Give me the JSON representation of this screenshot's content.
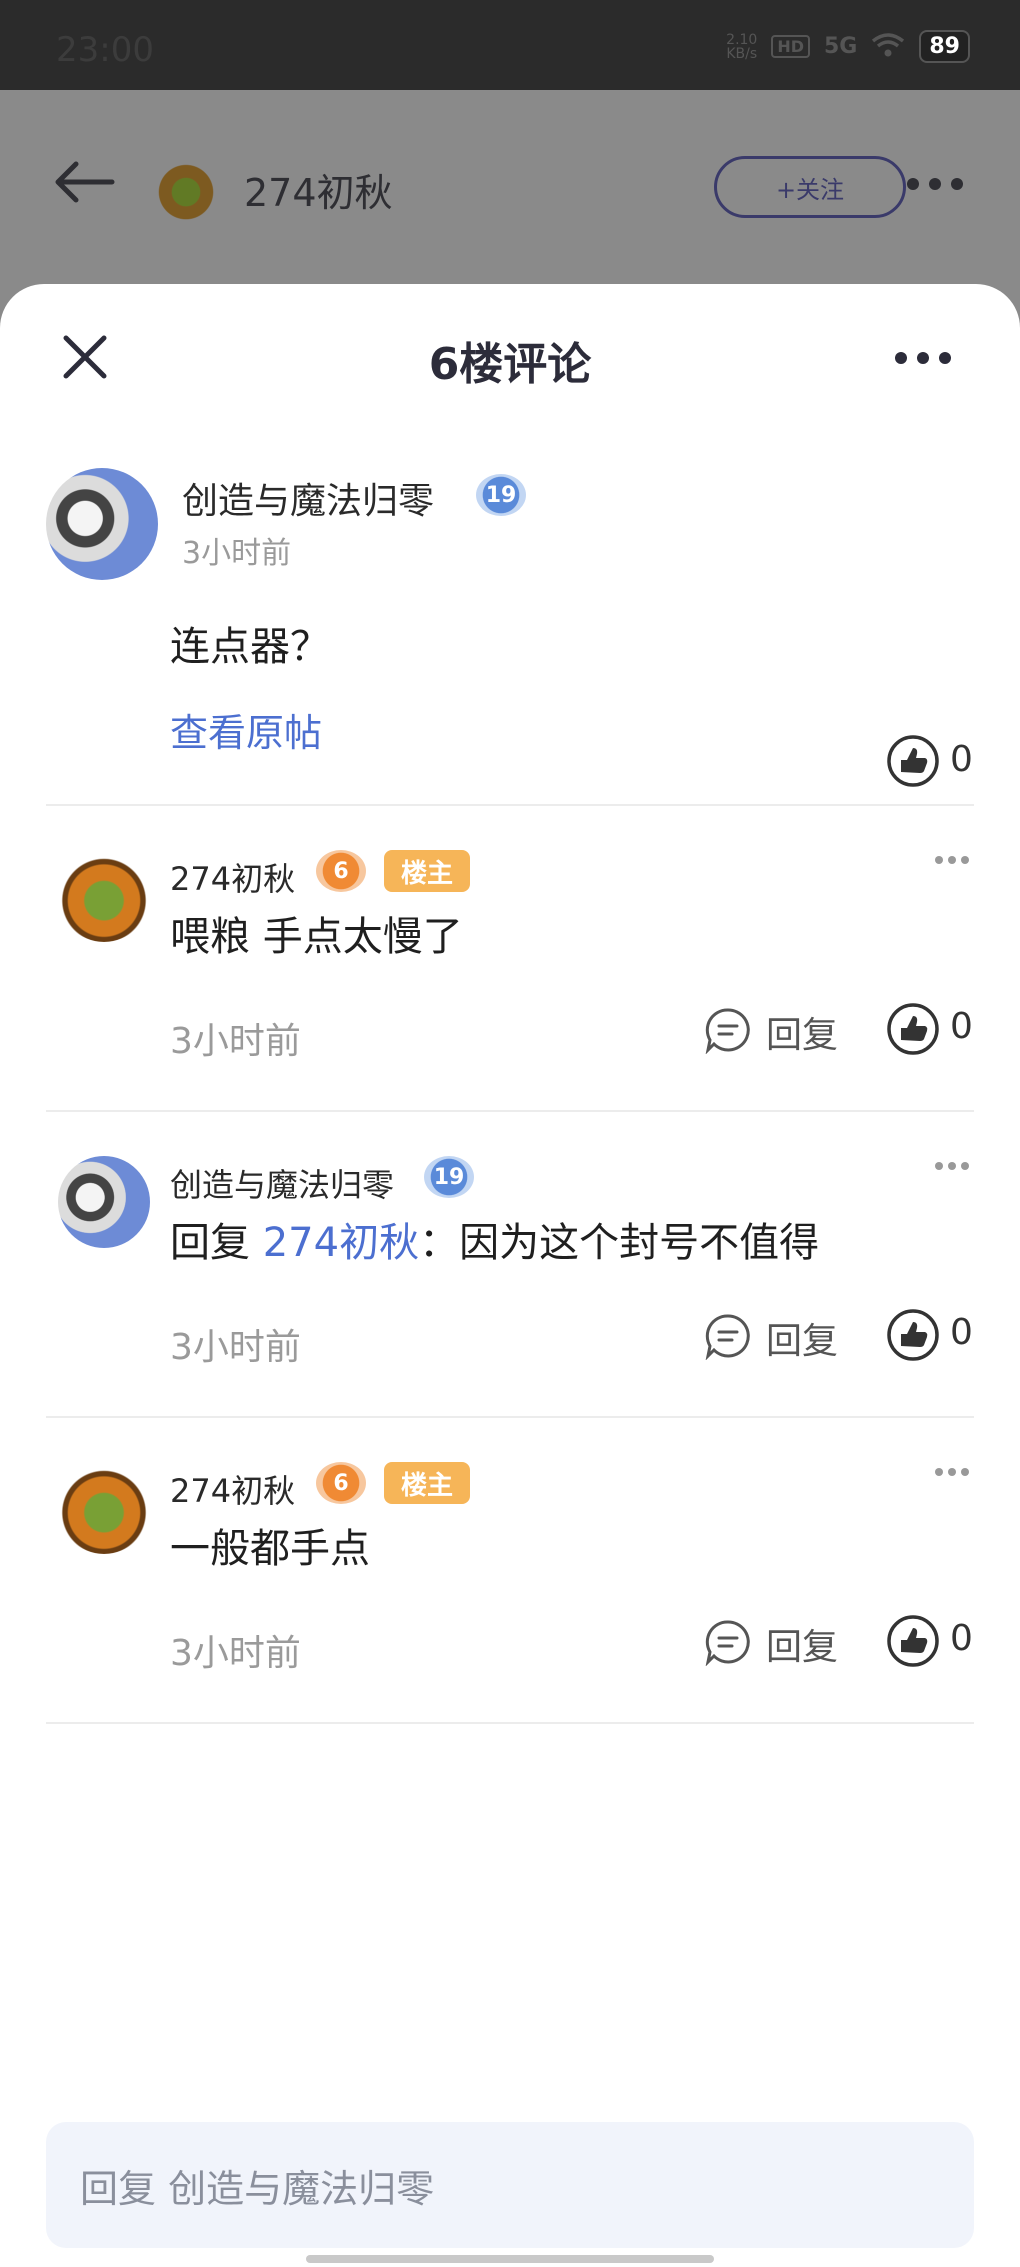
{
  "status_bar": {
    "time": "23:00",
    "net_speed_value": "2.10",
    "net_speed_unit": "KB/s",
    "hd": "HD",
    "signal": "5G",
    "battery": "89"
  },
  "header": {
    "user_name": "274初秋",
    "follow_label": "+关注"
  },
  "sheet": {
    "title": "6楼评论"
  },
  "main_post": {
    "author": "创造与魔法归零",
    "level": "19",
    "time": "3小时前",
    "content": "连点器？",
    "view_original": "查看原帖",
    "likes": "0"
  },
  "replies": [
    {
      "author": "274初秋",
      "level": "6",
      "owner_badge": "楼主",
      "content": "喂粮 手点太慢了",
      "time": "3小时前",
      "reply_label": "回复",
      "likes": "0"
    },
    {
      "author": "创造与魔法归零",
      "level": "19",
      "reply_prefix": "回复 ",
      "reply_target": "274初秋",
      "content": "：因为这个封号不值得",
      "time": "3小时前",
      "reply_label": "回复",
      "likes": "0"
    },
    {
      "author": "274初秋",
      "level": "6",
      "owner_badge": "楼主",
      "content": "一般都手点",
      "time": "3小时前",
      "reply_label": "回复",
      "likes": "0"
    }
  ],
  "input": {
    "placeholder": "回复 创造与魔法归零"
  },
  "colors": {
    "accent": "#4c6fd0",
    "owner_badge": "#f6b558"
  },
  "icons": [
    "back-arrow-icon",
    "close-icon",
    "more-icon",
    "like-icon",
    "reply-bubble-icon",
    "level-badge-icon"
  ]
}
